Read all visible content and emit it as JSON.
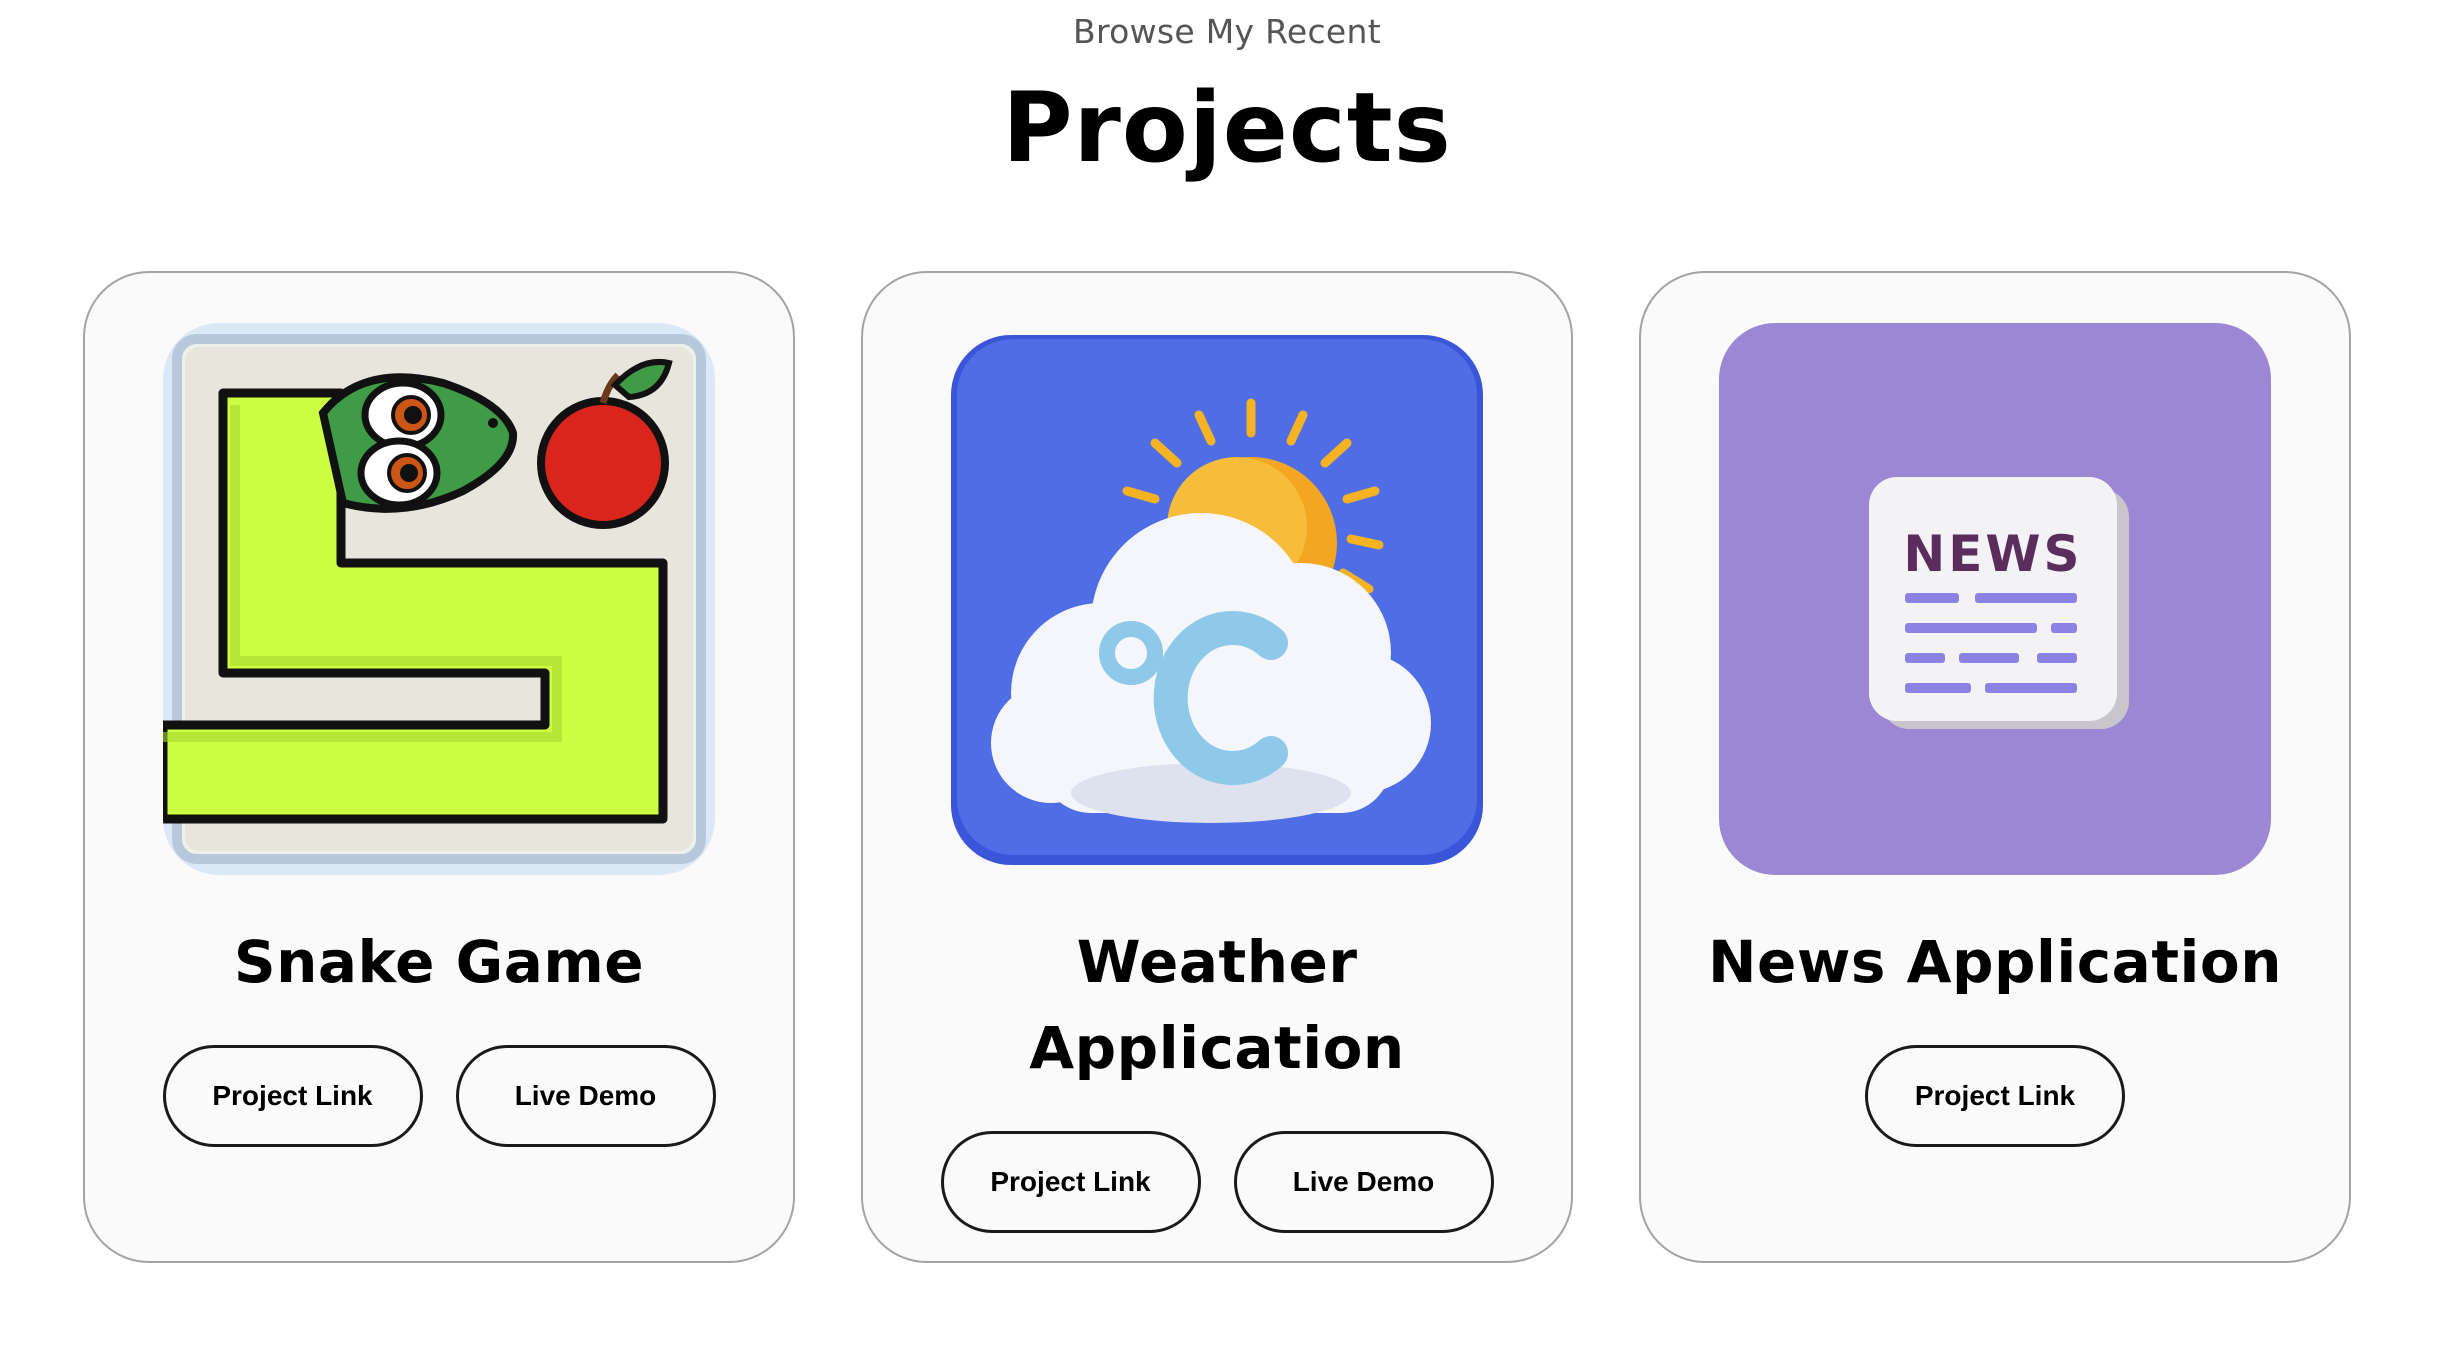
{
  "header": {
    "subtitle": "Browse My Recent",
    "title": "Projects"
  },
  "projects": [
    {
      "name": "Snake Game",
      "image_icon": "snake-game-icon",
      "buttons": [
        "Project Link",
        "Live Demo"
      ]
    },
    {
      "name": "Weather Application",
      "image_icon": "weather-icon",
      "image_text": "°C",
      "buttons": [
        "Project Link",
        "Live Demo"
      ]
    },
    {
      "name": "News Application",
      "image_icon": "news-icon",
      "image_text": "NEWS",
      "buttons": [
        "Project Link"
      ]
    }
  ],
  "colors": {
    "card_border": "#a3a3a3",
    "card_bg": "#fafafa",
    "snake_green": "#ccff44",
    "weather_blue": "#4f6ee6",
    "news_purple": "#9b87d3",
    "news_text": "#5a2d5c",
    "news_lines": "#8b82e3"
  }
}
